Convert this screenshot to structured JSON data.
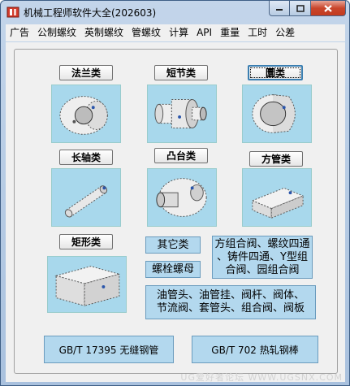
{
  "window": {
    "title": "机械工程师软件大全(202603)"
  },
  "menu": [
    "广告",
    "公制螺纹",
    "英制螺纹",
    "管螺纹",
    "计算",
    "API",
    "重量",
    "工时",
    "公差"
  ],
  "categories": {
    "flange": "法兰类",
    "shaft_joint": "短节类",
    "hoop": "圜类",
    "long_shaft": "长轴类",
    "boss": "凸台类",
    "square_tube": "方管类",
    "rectangle": "矩形类"
  },
  "buttons": {
    "others": "其它类",
    "bolt_nut": "螺栓螺母",
    "combo_line1": "方组合阀、螺纹四通",
    "combo_line2": "、铸件四通、Y型组",
    "combo_line3": "合阀、园组合阀",
    "pipe_line1": "油管头、油管挂、阀杆、阀体、",
    "pipe_line2": "节流阀、套管头、组合阀、阀板",
    "gb_seamless": "GB/T 17395 无缝钢管",
    "gb_hotrolled": "GB/T 702 热轧钢棒"
  },
  "watermark": "UG爱好者论坛 WWW.UGSNX.COM"
}
